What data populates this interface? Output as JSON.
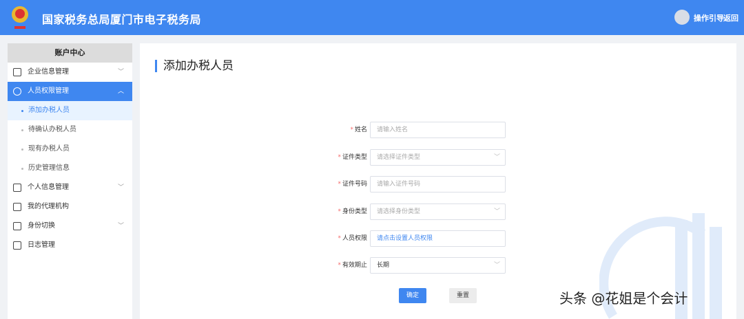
{
  "header": {
    "title": "国家税务总局厦门市电子税务局",
    "guide": "操作引导",
    "back": "返回"
  },
  "sidebar": {
    "heading": "账户中心",
    "items": [
      {
        "label": "企业信息管理",
        "expandable": true
      },
      {
        "label": "人员权限管理",
        "expandable": true,
        "active": true,
        "children": [
          "添加办税人员",
          "待确认办税人员",
          "现有办税人员",
          "历史管理信息"
        ]
      },
      {
        "label": "个人信息管理",
        "expandable": true
      },
      {
        "label": "我的代理机构",
        "expandable": false
      },
      {
        "label": "身份切换",
        "expandable": true
      },
      {
        "label": "日志管理",
        "expandable": false
      }
    ]
  },
  "main": {
    "title": "添加办税人员",
    "form": [
      {
        "label": "姓名",
        "placeholder": "请输入姓名",
        "type": "input"
      },
      {
        "label": "证件类型",
        "placeholder": "请选择证件类型",
        "type": "select"
      },
      {
        "label": "证件号码",
        "placeholder": "请输入证件号码",
        "type": "input"
      },
      {
        "label": "身份类型",
        "placeholder": "请选择身份类型",
        "type": "select"
      },
      {
        "label": "人员权限",
        "value": "请点击设置人员权限",
        "type": "link"
      },
      {
        "label": "有效期止",
        "value": "长期",
        "type": "select"
      }
    ],
    "required_mark": "*",
    "confirm": "确定",
    "reset": "重置"
  },
  "watermark": "头条 @花姐是个会计",
  "colors": {
    "primary": "#3f87f0",
    "required": "#f56c6c"
  }
}
